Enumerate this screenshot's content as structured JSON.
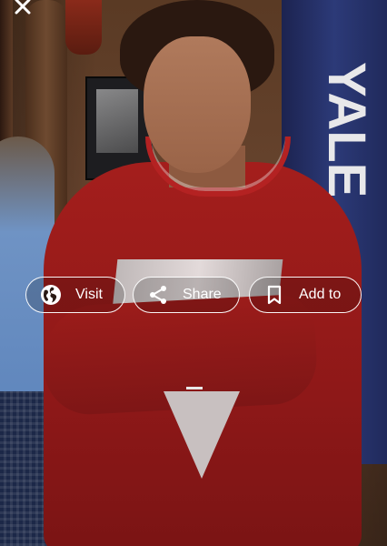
{
  "viewer": {
    "close_icon": "close-icon",
    "photo_banner_text": "YALE"
  },
  "actions": {
    "visit": {
      "label": "Visit",
      "icon": "globe-icon"
    },
    "share": {
      "label": "Share",
      "icon": "share-icon"
    },
    "add_to": {
      "label": "Add to",
      "icon": "bookmark-icon"
    }
  },
  "colors": {
    "pill_border": "#ffffff",
    "pill_text": "#ffffff",
    "sweater": "#a41e1c"
  }
}
